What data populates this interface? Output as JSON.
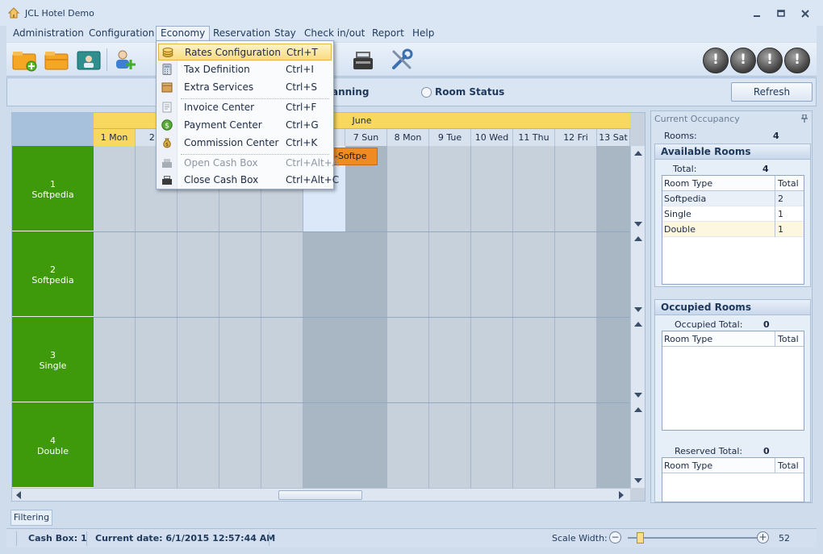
{
  "window": {
    "title": "JCL Hotel Demo"
  },
  "menu": {
    "items": [
      "Administration",
      "Configuration",
      "Economy",
      "Reservation",
      "Stay",
      "Check in/out",
      "Report",
      "Help"
    ]
  },
  "economy_menu": {
    "items": [
      {
        "label": "Rates Configuration",
        "shortcut": "Ctrl+T",
        "icon": "coins-icon",
        "disabled": false
      },
      {
        "label": "Tax Definition",
        "shortcut": "Ctrl+I",
        "icon": "calculator-icon",
        "disabled": false
      },
      {
        "label": "Extra Services",
        "shortcut": "Ctrl+S",
        "icon": "box-icon",
        "disabled": false
      },
      {
        "label": "Invoice Center",
        "shortcut": "Ctrl+F",
        "icon": "invoice-icon",
        "disabled": false
      },
      {
        "label": "Payment Center",
        "shortcut": "Ctrl+G",
        "icon": "dollar-coin-icon",
        "disabled": false
      },
      {
        "label": "Commission Center",
        "shortcut": "Ctrl+K",
        "icon": "money-bag-icon",
        "disabled": false
      },
      {
        "label": "Open Cash Box",
        "shortcut": "Ctrl+Alt+A",
        "icon": "cash-register-icon",
        "disabled": true
      },
      {
        "label": "Close Cash Box",
        "shortcut": "Ctrl+Alt+C",
        "icon": "cash-register-icon",
        "disabled": false
      }
    ]
  },
  "subbar": {
    "planning_label": "anning",
    "room_status_label": "Room Status",
    "refresh_label": "Refresh"
  },
  "alerts": [
    "!",
    "!",
    "!",
    "!"
  ],
  "planner": {
    "month": "June",
    "days": [
      "1 Mon",
      "2 T",
      "",
      "",
      "",
      "",
      "7 Sun",
      "8 Mon",
      "9 Tue",
      "10 Wed",
      "11 Thu",
      "12 Fri",
      "13 Sat"
    ],
    "rooms": [
      {
        "number": "1",
        "type": "Softpedia"
      },
      {
        "number": "2",
        "type": "Softpedia"
      },
      {
        "number": "3",
        "type": "Single"
      },
      {
        "number": "4",
        "type": "Double"
      }
    ],
    "booking_label": "-Softpe"
  },
  "occupancy": {
    "header": "Current Occupancy",
    "rooms_label": "Rooms:",
    "rooms_count": "4",
    "available": {
      "title": "Available Rooms",
      "total_label": "Total:",
      "total": "4",
      "columns": [
        "Room Type",
        "Total"
      ],
      "rows": [
        [
          "Softpedia",
          "2"
        ],
        [
          "Single",
          "1"
        ],
        [
          "Double",
          "1"
        ]
      ]
    },
    "occupied": {
      "title": "Occupied Rooms",
      "total_label": "Occupied Total:",
      "total": "0",
      "columns": [
        "Room Type",
        "Total"
      ],
      "reserved_label": "Reserved Total:",
      "reserved_total": "0",
      "reserved_columns": [
        "Room Type",
        "Total"
      ]
    }
  },
  "filter_tab": "Filtering",
  "status": {
    "cash_box": "Cash Box: 1",
    "current_date": "Current date: 6/1/2015 12:57:44 AM",
    "scale_label": "Scale Width:",
    "scale_value": "52"
  },
  "colors": {
    "room_green": "#3f9a0b",
    "today": "#f8d85f",
    "booking": "#f08a23",
    "menu_hover": "#f9dc80"
  }
}
